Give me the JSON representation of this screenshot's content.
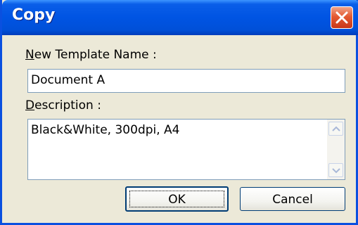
{
  "window": {
    "title": "Copy",
    "close_icon": "close-icon"
  },
  "form": {
    "name_label": {
      "mnemonic": "N",
      "rest": "ew Template Name :"
    },
    "name_value": "Document A",
    "description_label": {
      "mnemonic": "D",
      "rest": "escription :"
    },
    "description_value": "Black&White, 300dpi, A4"
  },
  "scrollbar": {
    "up_icon": "scroll-up-arrow-icon",
    "down_icon": "scroll-down-arrow-icon"
  },
  "buttons": {
    "ok_label": "OK",
    "cancel_label": "Cancel"
  },
  "colors": {
    "titlebar": "#0054e3",
    "close_button": "#e45a32",
    "dialog_background": "#ece9d8",
    "input_border": "#7f9db9"
  }
}
